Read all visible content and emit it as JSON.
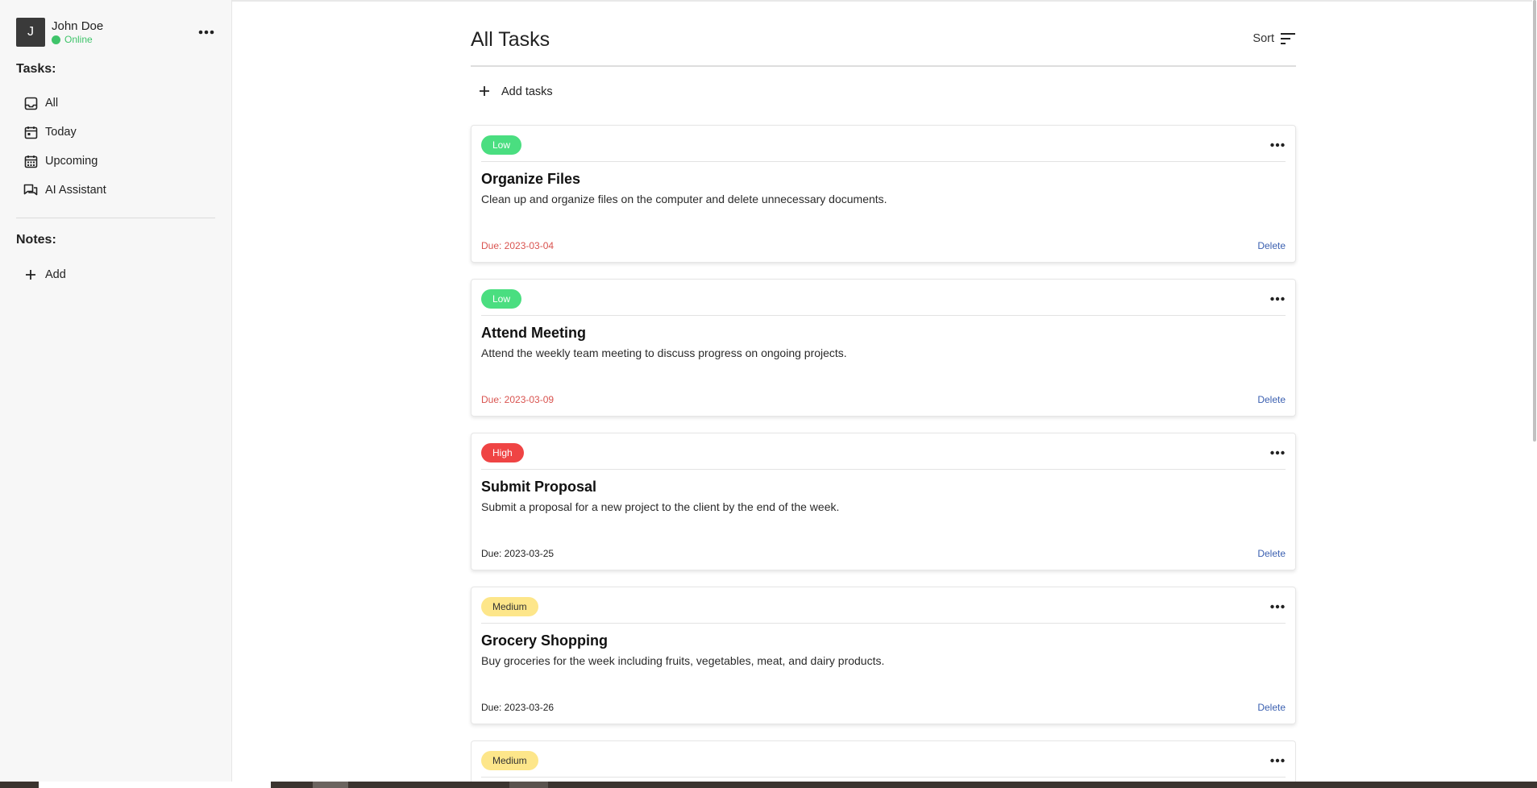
{
  "user": {
    "initial": "J",
    "name": "John Doe",
    "status": "Online"
  },
  "sidebar": {
    "tasks_heading": "Tasks:",
    "tasks_items": [
      {
        "label": "All",
        "icon": "inbox-icon"
      },
      {
        "label": "Today",
        "icon": "calendar-day-icon"
      },
      {
        "label": "Upcoming",
        "icon": "calendar-month-icon"
      },
      {
        "label": "AI Assistant",
        "icon": "chat-icon"
      }
    ],
    "notes_heading": "Notes:",
    "notes_add_label": "Add"
  },
  "main": {
    "title": "All Tasks",
    "sort_label": "Sort",
    "add_tasks_label": "Add tasks",
    "tasks": [
      {
        "priority": "Low",
        "priority_class": "low",
        "title": "Organize Files",
        "description": "Clean up and organize files on the computer and delete unnecessary documents.",
        "due": "Due: 2023-03-04",
        "due_class": "overdue",
        "delete_label": "Delete"
      },
      {
        "priority": "Low",
        "priority_class": "low",
        "title": "Attend Meeting",
        "description": "Attend the weekly team meeting to discuss progress on ongoing projects.",
        "due": "Due: 2023-03-09",
        "due_class": "overdue",
        "delete_label": "Delete"
      },
      {
        "priority": "High",
        "priority_class": "high",
        "title": "Submit Proposal",
        "description": "Submit a proposal for a new project to the client by the end of the week.",
        "due": "Due: 2023-03-25",
        "due_class": "normal",
        "delete_label": "Delete"
      },
      {
        "priority": "Medium",
        "priority_class": "medium",
        "title": "Grocery Shopping",
        "description": "Buy groceries for the week including fruits, vegetables, meat, and dairy products.",
        "due": "Due: 2023-03-26",
        "due_class": "normal",
        "delete_label": "Delete"
      },
      {
        "priority": "Medium",
        "priority_class": "medium"
      }
    ]
  },
  "colors": {
    "online": "#3fc46a",
    "low": "#4ade80",
    "high": "#ef4444",
    "medium": "#fde68a",
    "overdue": "#d9534f",
    "link": "#3a5fb0"
  }
}
